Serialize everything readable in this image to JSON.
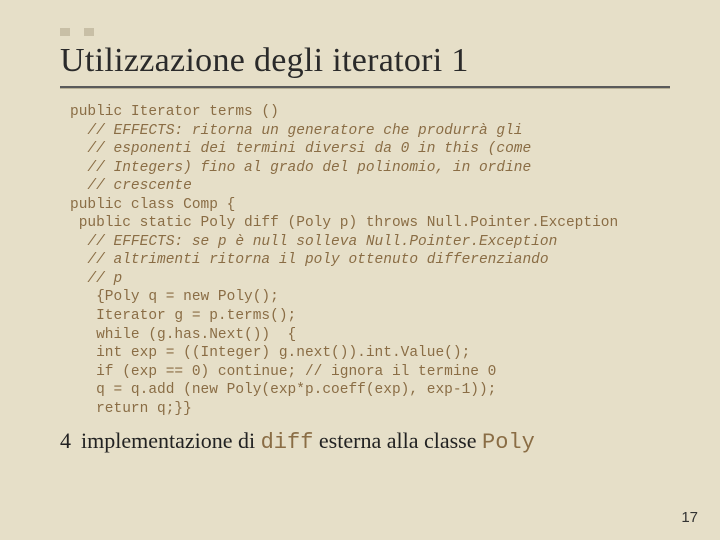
{
  "title": "Utilizzazione degli iteratori 1",
  "code": {
    "l1": "public Iterator terms ()",
    "l2": "  // EFFECTS: ritorna un generatore che produrrà gli",
    "l3": "  // esponenti dei termini diversi da 0 in this (come",
    "l4": "  // Integers) fino al grado del polinomio, in ordine",
    "l5": "  // crescente",
    "l6": "public class Comp {",
    "l7": " public static Poly diff (Poly p) throws Null.Pointer.Exception",
    "l8": "  // EFFECTS: se p è null solleva Null.Pointer.Exception",
    "l9": "  // altrimenti ritorna il poly ottenuto differenziando",
    "l10": "  // p",
    "l11": "   {Poly q = new Poly();",
    "l12": "   Iterator g = p.terms();",
    "l13": "   while (g.has.Next())  {",
    "l14": "   int exp = ((Integer) g.next()).int.Value();",
    "l15": "   if (exp == 0) continue; // ignora il termine 0",
    "l16": "   q = q.add (new Poly(exp*p.coeff(exp), exp-1));",
    "l17": "   return q;}}"
  },
  "bullet": {
    "num": "4",
    "pre": "implementazione di ",
    "mono1": "diff",
    "mid": " esterna alla classe ",
    "mono2": "Poly"
  },
  "pagenum": "17"
}
